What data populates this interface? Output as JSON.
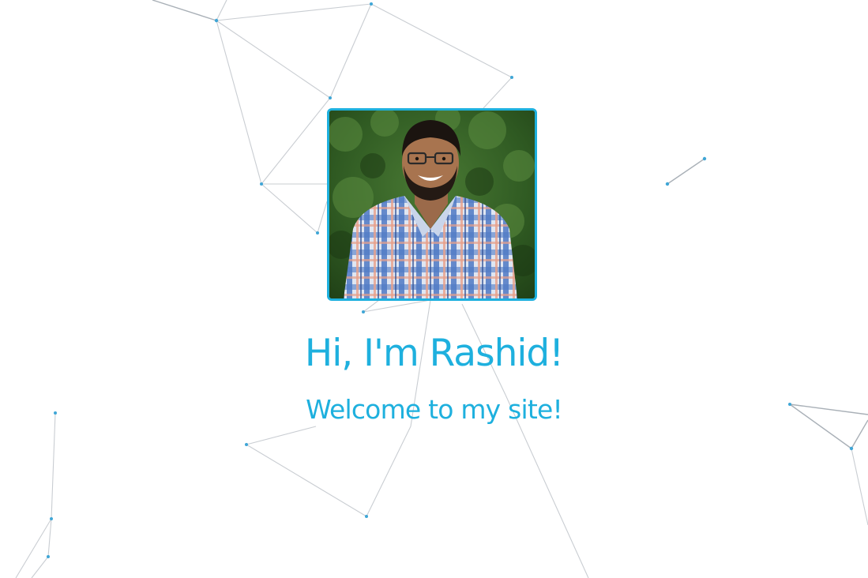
{
  "hero": {
    "title": "Hi, I'm Rashid!",
    "subtitle": "Welcome to my site!"
  },
  "colors": {
    "accent": "#1eb0de",
    "background": "#ffffff",
    "network_line": "#c9cdd2",
    "network_node": "#3fa6d6"
  }
}
